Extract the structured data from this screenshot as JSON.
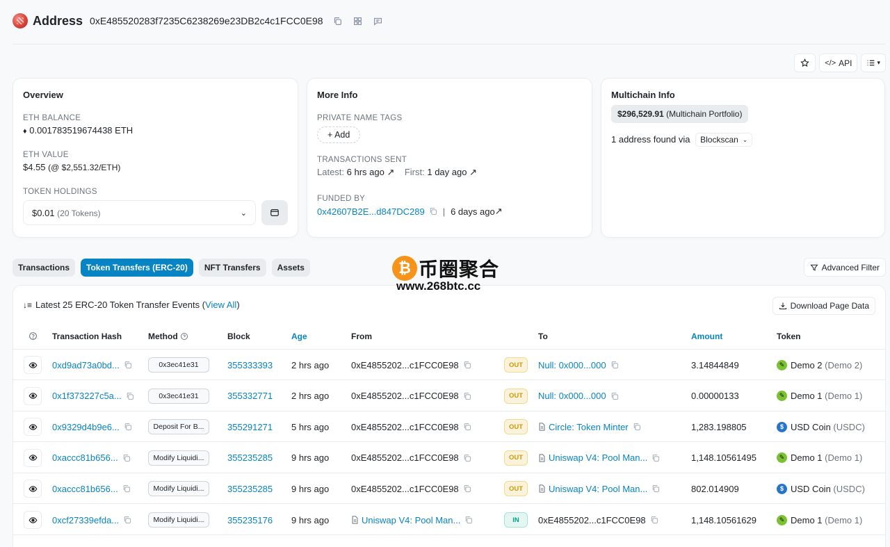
{
  "header": {
    "title": "Address",
    "address": "0xE485520283f7235C6238269e23DB2c4c1FCC0E98"
  },
  "topbar": {
    "api_label": "API"
  },
  "overview": {
    "title": "Overview",
    "eth_balance_label": "ETH BALANCE",
    "eth_balance": "0.001783519674438 ETH",
    "eth_value_label": "ETH VALUE",
    "eth_value": "$4.55",
    "eth_price": "(@ $2,551.32/ETH)",
    "token_holdings_label": "TOKEN HOLDINGS",
    "token_holdings_value": "$0.01",
    "token_holdings_count": "(20 Tokens)"
  },
  "more_info": {
    "title": "More Info",
    "private_tags_label": "PRIVATE NAME TAGS",
    "add_label": "+ Add",
    "tx_sent_label": "TRANSACTIONS SENT",
    "latest_label": "Latest:",
    "latest_value": "6 hrs ago",
    "first_label": "First:",
    "first_value": "1 day ago",
    "funded_by_label": "FUNDED BY",
    "funded_by_address": "0x42607B2E...d847DC289",
    "funded_by_age": "6 days ago"
  },
  "multichain": {
    "title": "Multichain Info",
    "portfolio_value": "$296,529.91",
    "portfolio_label": "(Multichain Portfolio)",
    "found_text": "1 address found via",
    "source": "Blockscan"
  },
  "tabs": [
    {
      "label": "Transactions"
    },
    {
      "label": "Token Transfers (ERC-20)"
    },
    {
      "label": "NFT Transfers"
    },
    {
      "label": "Assets"
    }
  ],
  "advanced_filter": "Advanced Filter",
  "watermark": {
    "text": "币圈聚合",
    "url": "www.268btc.cc"
  },
  "table": {
    "summary_prefix": "Latest 25 ERC-20 Token Transfer Events (",
    "view_all": "View All",
    "summary_suffix": ")",
    "download_label": "Download Page Data",
    "headers": {
      "hash": "Transaction Hash",
      "method": "Method",
      "block": "Block",
      "age": "Age",
      "from": "From",
      "to": "To",
      "amount": "Amount",
      "token": "Token"
    },
    "rows": [
      {
        "hash": "0xd9ad73a0bd...",
        "method": "0x3ec41e31",
        "block": "355333393",
        "age": "2 hrs ago",
        "from": "0xE4855202...c1FCC0E98",
        "direction": "OUT",
        "to": "Null: 0x000...000",
        "amount": "3.14844849",
        "token": "Demo 2",
        "token_symbol": "(Demo 2)"
      },
      {
        "hash": "0x1f373227c5a...",
        "method": "0x3ec41e31",
        "block": "355332771",
        "age": "2 hrs ago",
        "from": "0xE4855202...c1FCC0E98",
        "direction": "OUT",
        "to": "Null: 0x000...000",
        "amount": "0.00000133",
        "token": "Demo 1",
        "token_symbol": "(Demo 1)"
      },
      {
        "hash": "0x9329d4b9e6...",
        "method": "Deposit For B...",
        "block": "355291271",
        "age": "5 hrs ago",
        "from": "0xE4855202...c1FCC0E98",
        "direction": "OUT",
        "to": "Circle: Token Minter",
        "amount": "1,283.198805",
        "token": "USD Coin",
        "token_symbol": "(USDC)"
      },
      {
        "hash": "0xaccc81b656...",
        "method": "Modify Liquidi...",
        "block": "355235285",
        "age": "9 hrs ago",
        "from": "0xE4855202...c1FCC0E98",
        "direction": "OUT",
        "to": "Uniswap V4: Pool Man...",
        "amount": "1,148.10561495",
        "token": "Demo 1",
        "token_symbol": "(Demo 1)"
      },
      {
        "hash": "0xaccc81b656...",
        "method": "Modify Liquidi...",
        "block": "355235285",
        "age": "9 hrs ago",
        "from": "0xE4855202...c1FCC0E98",
        "direction": "OUT",
        "to": "Uniswap V4: Pool Man...",
        "amount": "802.014909",
        "token": "USD Coin",
        "token_symbol": "(USDC)"
      },
      {
        "hash": "0xcf27339efda...",
        "method": "Modify Liquidi...",
        "block": "355235176",
        "age": "9 hrs ago",
        "from": "Uniswap V4: Pool Man...",
        "direction": "IN",
        "to": "0xE4855202...c1FCC0E98",
        "amount": "1,148.10561629",
        "token": "Demo 1",
        "token_symbol": "(Demo 1)"
      }
    ]
  },
  "colors": {
    "link": "#0784c3",
    "out_badge": "#cc9a06",
    "in_badge": "#00a186"
  }
}
